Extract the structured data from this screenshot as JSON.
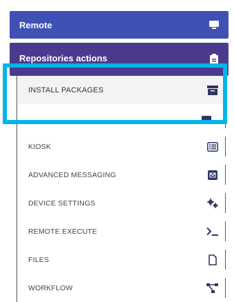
{
  "headers": {
    "remote": {
      "label": "Remote",
      "icon": "monitor-icon"
    },
    "repositories": {
      "label": "Repositories actions",
      "icon": "clipboard-icon"
    }
  },
  "menu": {
    "items": [
      {
        "label": "INSTALL PACKAGES",
        "icon": "archive-icon",
        "selected": true
      },
      {
        "label": "",
        "icon": "hidden-icon"
      },
      {
        "label": "KIOSK",
        "icon": "list-icon"
      },
      {
        "label": "ADVANCED MESSAGING",
        "icon": "envelope-icon"
      },
      {
        "label": "DEVICE SETTINGS",
        "icon": "cogs-icon"
      },
      {
        "label": "REMOTE EXECUTE",
        "icon": "terminal-icon"
      },
      {
        "label": "FILES",
        "icon": "file-icon"
      },
      {
        "label": "WORKFLOW",
        "icon": "workflow-icon"
      }
    ]
  },
  "colors": {
    "remote_header": "#3f51b5",
    "repo_header": "#4b3b8f",
    "highlight": "#00b6e8",
    "icon": "#2e3560"
  }
}
